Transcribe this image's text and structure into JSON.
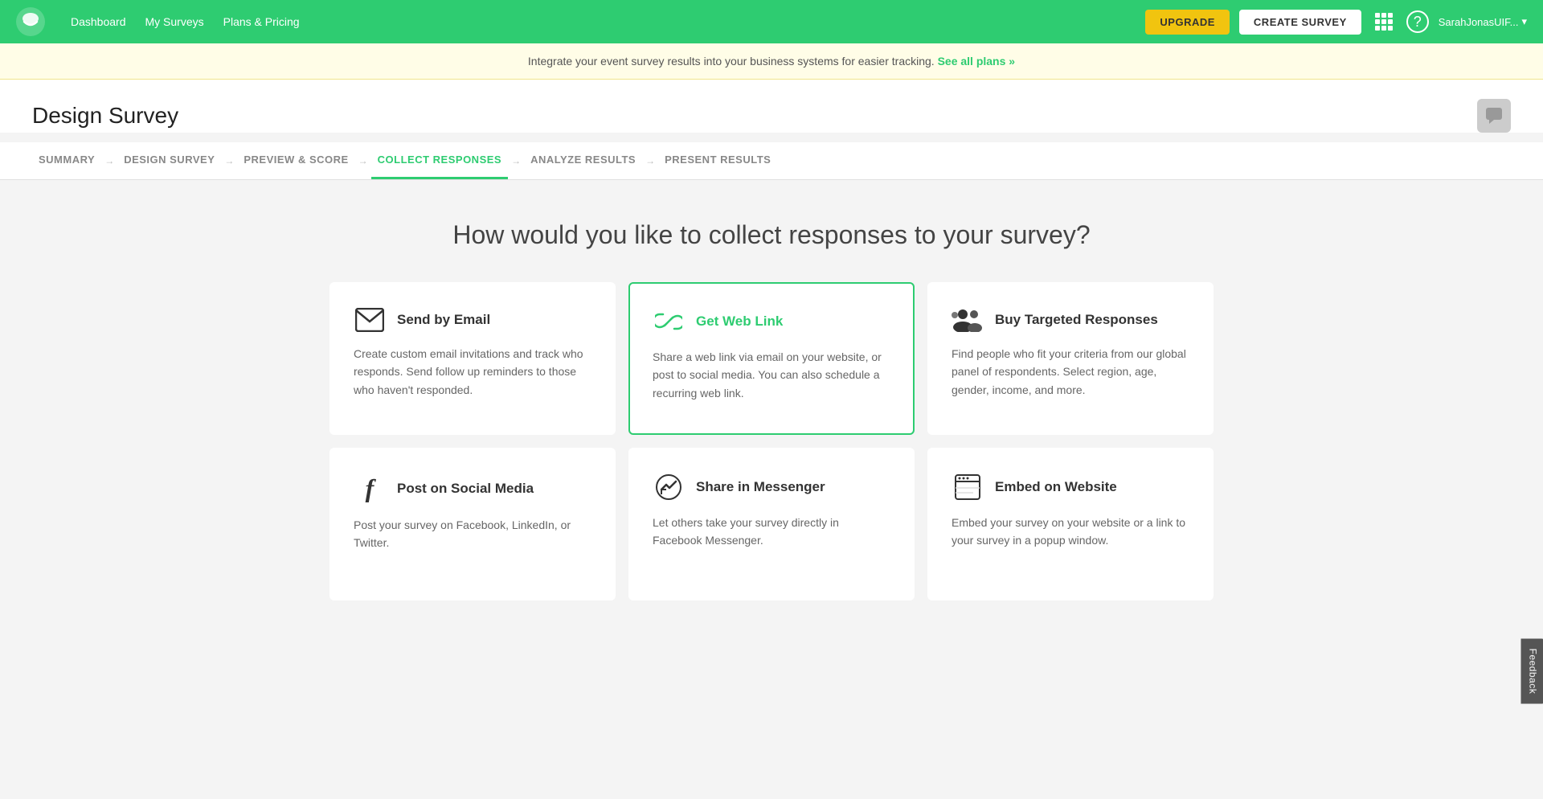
{
  "header": {
    "nav": [
      {
        "label": "Dashboard",
        "name": "dashboard-link"
      },
      {
        "label": "My Surveys",
        "name": "my-surveys-link"
      },
      {
        "label": "Plans & Pricing",
        "name": "plans-pricing-link"
      }
    ],
    "upgrade_label": "UPGRADE",
    "create_survey_label": "CREATE SURVEY",
    "user_name": "SarahJonasUIF...",
    "logo_alt": "SurveyMonkey"
  },
  "banner": {
    "text": "Integrate your event survey results into your business systems for easier tracking.",
    "link_text": "See all plans »"
  },
  "page": {
    "title": "Design Survey",
    "section_question": "How would you like to collect responses to your survey?"
  },
  "breadcrumbs": [
    {
      "label": "SUMMARY",
      "active": false
    },
    {
      "label": "DESIGN SURVEY",
      "active": false
    },
    {
      "label": "PREVIEW & SCORE",
      "active": false
    },
    {
      "label": "COLLECT RESPONSES",
      "active": true
    },
    {
      "label": "ANALYZE RESULTS",
      "active": false
    },
    {
      "label": "PRESENT RESULTS",
      "active": false
    }
  ],
  "cards": [
    {
      "id": "send-email",
      "icon": "✉",
      "title": "Send by Email",
      "desc": "Create custom email invitations and track who responds. Send follow up reminders to those who haven't responded.",
      "selected": false
    },
    {
      "id": "get-web-link",
      "icon": "🔗",
      "title": "Get Web Link",
      "desc": "Share a web link via email on your website, or post to social media. You can also schedule a recurring web link.",
      "selected": true
    },
    {
      "id": "buy-targeted",
      "icon": "👥",
      "title": "Buy Targeted Responses",
      "desc": "Find people who fit your criteria from our global panel of respondents. Select region, age, gender, income, and more.",
      "selected": false
    },
    {
      "id": "post-social",
      "icon": "f",
      "title": "Post on Social Media",
      "desc": "Post your survey on Facebook, LinkedIn, or Twitter.",
      "selected": false
    },
    {
      "id": "share-messenger",
      "icon": "💬",
      "title": "Share in Messenger",
      "desc": "Let others take your survey directly in Facebook Messenger.",
      "selected": false
    },
    {
      "id": "embed-website",
      "icon": "📄",
      "title": "Embed on Website",
      "desc": "Embed your survey on your website or a link to your survey in a popup window.",
      "selected": false
    }
  ],
  "feedback": {
    "label": "Feedback"
  },
  "colors": {
    "green": "#2ecc71",
    "yellow": "#f1c40f"
  }
}
